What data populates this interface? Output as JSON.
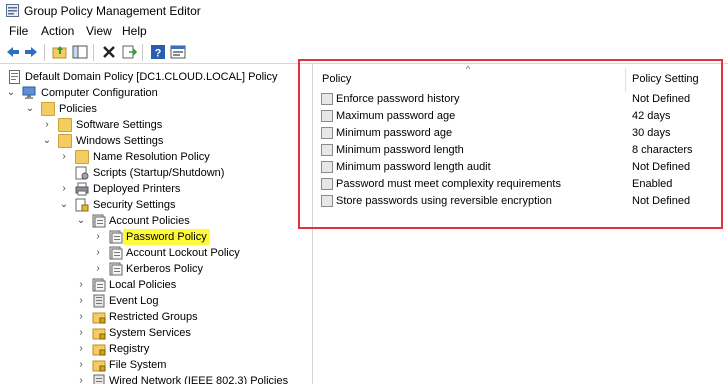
{
  "window": {
    "title": "Group Policy Management Editor"
  },
  "menu": [
    "File",
    "Action",
    "View",
    "Help"
  ],
  "toolbar": [
    "back-arrow-icon",
    "forward-arrow-icon",
    "up-folder-icon",
    "show-hide-tree-icon",
    "delete-icon",
    "export-icon",
    "help-icon",
    "properties-icon"
  ],
  "tree": {
    "root": "Default Domain Policy [DC1.CLOUD.LOCAL] Policy",
    "computer_configuration": "Computer Configuration",
    "policies": "Policies",
    "software_settings": "Software Settings",
    "windows_settings": "Windows Settings",
    "name_resolution_policy": "Name Resolution Policy",
    "scripts": "Scripts (Startup/Shutdown)",
    "deployed_printers": "Deployed Printers",
    "security_settings": "Security Settings",
    "account_policies": "Account Policies",
    "password_policy": "Password Policy",
    "account_lockout_policy": "Account Lockout Policy",
    "kerberos_policy": "Kerberos Policy",
    "local_policies": "Local Policies",
    "event_log": "Event Log",
    "restricted_groups": "Restricted Groups",
    "system_services": "System Services",
    "registry": "Registry",
    "file_system": "File System",
    "wired_network": "Wired Network (IEEE 802.3) Policies"
  },
  "list": {
    "columns": {
      "policy": "Policy",
      "setting": "Policy Setting"
    },
    "rows": [
      {
        "policy": "Enforce password history",
        "setting": "Not Defined"
      },
      {
        "policy": "Maximum password age",
        "setting": "42 days"
      },
      {
        "policy": "Minimum password age",
        "setting": "30 days"
      },
      {
        "policy": "Minimum password length",
        "setting": "8 characters"
      },
      {
        "policy": "Minimum password length audit",
        "setting": "Not Defined"
      },
      {
        "policy": "Password must meet complexity requirements",
        "setting": "Enabled"
      },
      {
        "policy": "Store passwords using reversible encryption",
        "setting": "Not Defined"
      }
    ]
  },
  "colors": {
    "highlight": "#fffb3a",
    "annotation_box": "#e3323c",
    "folder": "#f4cd62"
  }
}
